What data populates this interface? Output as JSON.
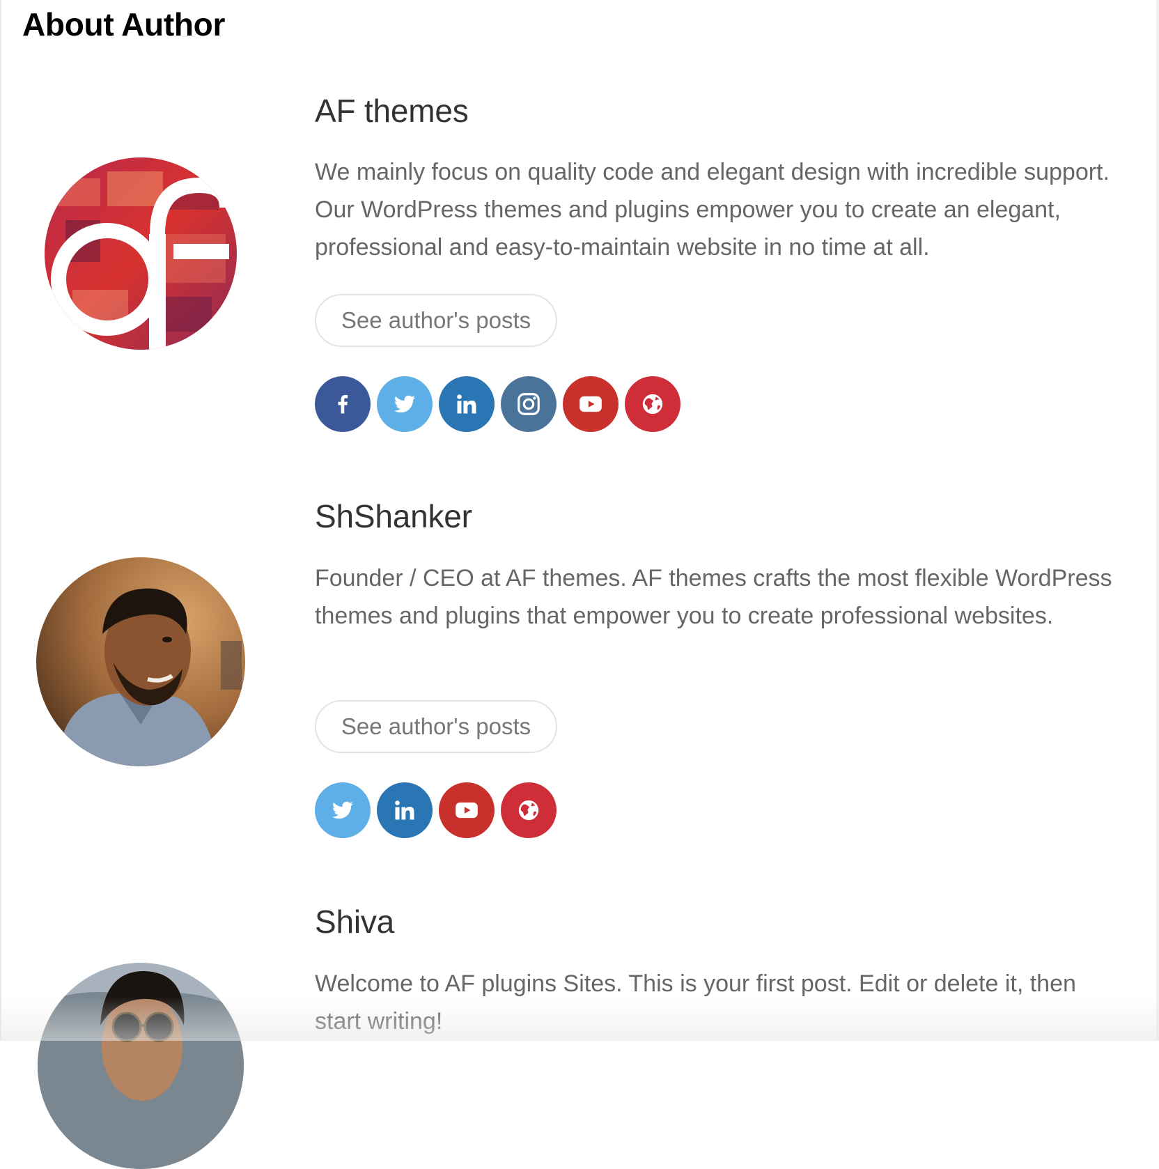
{
  "section": {
    "title": "About Author"
  },
  "authors": [
    {
      "name": "AF themes",
      "bio": "We mainly focus on quality code and elegant design with incredible support. Our WordPress themes and plugins empower you to create an elegant, professional and easy-to-maintain website in no time at all.",
      "posts_label": "See author's posts",
      "socials": [
        "facebook",
        "twitter",
        "linkedin",
        "instagram",
        "youtube",
        "website"
      ]
    },
    {
      "name": "ShShanker",
      "bio": "Founder / CEO at AF themes. AF themes crafts the most flexible WordPress themes and plugins that empower you to create professional websites.",
      "posts_label": "See author's posts",
      "socials": [
        "twitter",
        "linkedin",
        "youtube",
        "website"
      ]
    },
    {
      "name": "Shiva",
      "bio": "Welcome to AF plugins Sites. This is your first post. Edit or delete it, then start writing!"
    }
  ],
  "colors": {
    "facebook": "#3b5998",
    "twitter": "#5eaee8",
    "linkedin": "#2a75b3",
    "instagram": "#4a7399",
    "youtube": "#c7302b",
    "website": "#cf2d37",
    "name_text": "#333333",
    "bio_text": "#666666"
  }
}
